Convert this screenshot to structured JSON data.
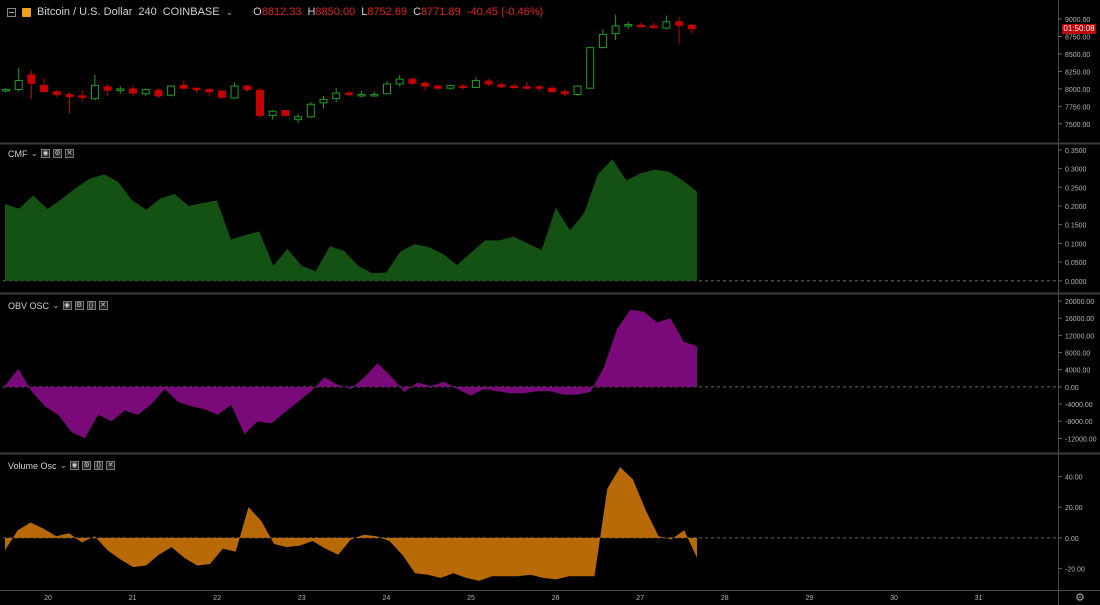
{
  "header": {
    "symbol": "Bitcoin / U.S. Dollar",
    "interval": "240",
    "exchange": "COINBASE",
    "open_label": "O",
    "open": "8812.33",
    "high_label": "H",
    "high": "8850.00",
    "low_label": "L",
    "low": "8752.69",
    "close_label": "C",
    "close": "8771.89",
    "change": "-40.45 (-0.46%)",
    "countdown": "01:50:08"
  },
  "panes": {
    "cmf_label": "CMF",
    "obv_label": "OBV OSC",
    "vol_label": "Volume Osc"
  },
  "colors": {
    "up": "#0c7a0c",
    "down": "#c40000",
    "cmf": "#145214",
    "obv": "#7a0a7a",
    "vol": "#b86a08",
    "grid": "#3a3a3a",
    "text": "#b4b4b4"
  },
  "icons": [
    "collapse-icon",
    "caret-down-icon",
    "eye-icon",
    "settings-icon",
    "close-icon",
    "gear-icon"
  ],
  "chart_data": [
    {
      "type": "candlestick",
      "title": "Bitcoin / U.S. Dollar",
      "x_ticks": [
        "20",
        "21",
        "22",
        "23",
        "24",
        "25",
        "26",
        "27",
        "28",
        "29",
        "30",
        "31"
      ],
      "y_ticks": [
        "9000.00",
        "8750.00",
        "8500.00",
        "8250.00",
        "8000.00",
        "7750.00",
        "7500.00"
      ],
      "ylim": [
        7340,
        9100
      ],
      "candles": [
        [
          7980,
          8010,
          7950,
          7990
        ],
        [
          7990,
          8300,
          7960,
          8120
        ],
        [
          8200,
          8260,
          7850,
          8080
        ],
        [
          8050,
          8150,
          7950,
          7960
        ],
        [
          7960,
          7990,
          7880,
          7920
        ],
        [
          7920,
          7950,
          7650,
          7890
        ],
        [
          7900,
          7980,
          7820,
          7880
        ],
        [
          7860,
          8200,
          7840,
          8050
        ],
        [
          8030,
          8070,
          7900,
          7980
        ],
        [
          7980,
          8040,
          7930,
          8000
        ],
        [
          8000,
          8050,
          7900,
          7940
        ],
        [
          7930,
          8000,
          7900,
          7990
        ],
        [
          7980,
          8010,
          7870,
          7900
        ],
        [
          7910,
          8050,
          7890,
          8040
        ],
        [
          8050,
          8120,
          7990,
          8010
        ],
        [
          8010,
          8020,
          7950,
          7990
        ],
        [
          7990,
          8010,
          7900,
          7960
        ],
        [
          7970,
          7980,
          7860,
          7880
        ],
        [
          7870,
          8090,
          7860,
          8040
        ],
        [
          8040,
          8060,
          7960,
          7990
        ],
        [
          7980,
          8010,
          7580,
          7620
        ],
        [
          7620,
          7700,
          7560,
          7680
        ],
        [
          7690,
          7700,
          7600,
          7620
        ],
        [
          7560,
          7640,
          7510,
          7600
        ],
        [
          7600,
          7810,
          7580,
          7780
        ],
        [
          7800,
          7900,
          7720,
          7850
        ],
        [
          7860,
          8010,
          7810,
          7940
        ],
        [
          7940,
          7970,
          7900,
          7920
        ],
        [
          7920,
          7970,
          7880,
          7920
        ],
        [
          7920,
          7960,
          7890,
          7920
        ],
        [
          7930,
          8110,
          7920,
          8070
        ],
        [
          8070,
          8200,
          8030,
          8140
        ],
        [
          8140,
          8160,
          8050,
          8080
        ],
        [
          8080,
          8110,
          7980,
          8040
        ],
        [
          8040,
          8060,
          7980,
          8010
        ],
        [
          8010,
          8060,
          7990,
          8050
        ],
        [
          8040,
          8070,
          7990,
          8020
        ],
        [
          8020,
          8170,
          8010,
          8120
        ],
        [
          8110,
          8150,
          8040,
          8070
        ],
        [
          8060,
          8090,
          8010,
          8030
        ],
        [
          8040,
          8070,
          8000,
          8020
        ],
        [
          8030,
          8100,
          7990,
          8020
        ],
        [
          8030,
          8060,
          7970,
          8010
        ],
        [
          8010,
          8040,
          7940,
          7960
        ],
        [
          7960,
          8000,
          7900,
          7930
        ],
        [
          7920,
          8050,
          7900,
          8040
        ],
        [
          8010,
          8450,
          8000,
          8590
        ],
        [
          8590,
          8850,
          8580,
          8780
        ],
        [
          8790,
          9060,
          8700,
          8900
        ],
        [
          8900,
          8960,
          8860,
          8920
        ],
        [
          8910,
          8950,
          8880,
          8900
        ],
        [
          8900,
          8950,
          8860,
          8880
        ],
        [
          8870,
          9050,
          8850,
          8960
        ],
        [
          8960,
          9030,
          8650,
          8910
        ],
        [
          8910,
          8930,
          8790,
          8860
        ]
      ]
    },
    {
      "type": "area",
      "title": "CMF",
      "y_ticks": [
        "0.3500",
        "0.3000",
        "0.2500",
        "0.2000",
        "0.1500",
        "0.1000",
        "0.0500",
        "0.0000"
      ],
      "ylim": [
        -0.006,
        0.355
      ],
      "values": [
        0.205,
        0.193,
        0.228,
        0.192,
        0.218,
        0.248,
        0.273,
        0.285,
        0.265,
        0.215,
        0.19,
        0.22,
        0.232,
        0.2,
        0.208,
        0.215,
        0.11,
        0.122,
        0.132,
        0.04,
        0.085,
        0.04,
        0.025,
        0.092,
        0.08,
        0.04,
        0.02,
        0.022,
        0.078,
        0.098,
        0.09,
        0.072,
        0.042,
        0.075,
        0.108,
        0.108,
        0.118,
        0.1,
        0.082,
        0.195,
        0.135,
        0.18,
        0.285,
        0.325,
        0.268,
        0.287,
        0.297,
        0.292,
        0.268,
        0.238
      ]
    },
    {
      "type": "area",
      "title": "OBV OSC",
      "y_ticks": [
        "20000.00",
        "16000.00",
        "12000.00",
        "8000.00",
        "4000.00",
        "0.00",
        "-4000.00",
        "-8000.00",
        "-12000.00"
      ],
      "ylim": [
        -14000,
        20000
      ],
      "baseline": 0,
      "values": [
        300,
        4200,
        -1000,
        -4500,
        -6500,
        -10500,
        -12000,
        -6500,
        -8000,
        -5500,
        -6500,
        -4000,
        -500,
        -3500,
        -4500,
        -5200,
        -6500,
        -4200,
        -11000,
        -8000,
        -8500,
        -6000,
        -3500,
        -1000,
        2200,
        500,
        -500,
        2200,
        5500,
        2500,
        -1200,
        1000,
        200,
        1200,
        -500,
        -2000,
        -500,
        -1000,
        -1500,
        -1500,
        -1000,
        -1000,
        -1800,
        -1800,
        -1200,
        4500,
        13500,
        18000,
        17500,
        15000,
        16000,
        10500,
        9500
      ]
    },
    {
      "type": "area",
      "title": "Volume Osc",
      "y_ticks": [
        "40.00",
        "20.00",
        "0.00",
        "-20.00"
      ],
      "ylim": [
        -30,
        50
      ],
      "baseline": 0,
      "values": [
        -8,
        5,
        10,
        6,
        1,
        3,
        -3,
        1,
        -8,
        -14,
        -19,
        -18,
        -11,
        -6,
        -13,
        -18,
        -17,
        -7,
        -9,
        20,
        11,
        -4,
        -6,
        -5,
        -2,
        -7,
        -11,
        -1,
        2,
        1,
        -2,
        -11,
        -23,
        -24,
        -26,
        -23,
        -26,
        -28,
        -25,
        -25,
        -25,
        -24,
        -26,
        -27,
        -25,
        -25,
        -25,
        32,
        46,
        38,
        18,
        1,
        -1,
        5,
        -13
      ]
    }
  ]
}
